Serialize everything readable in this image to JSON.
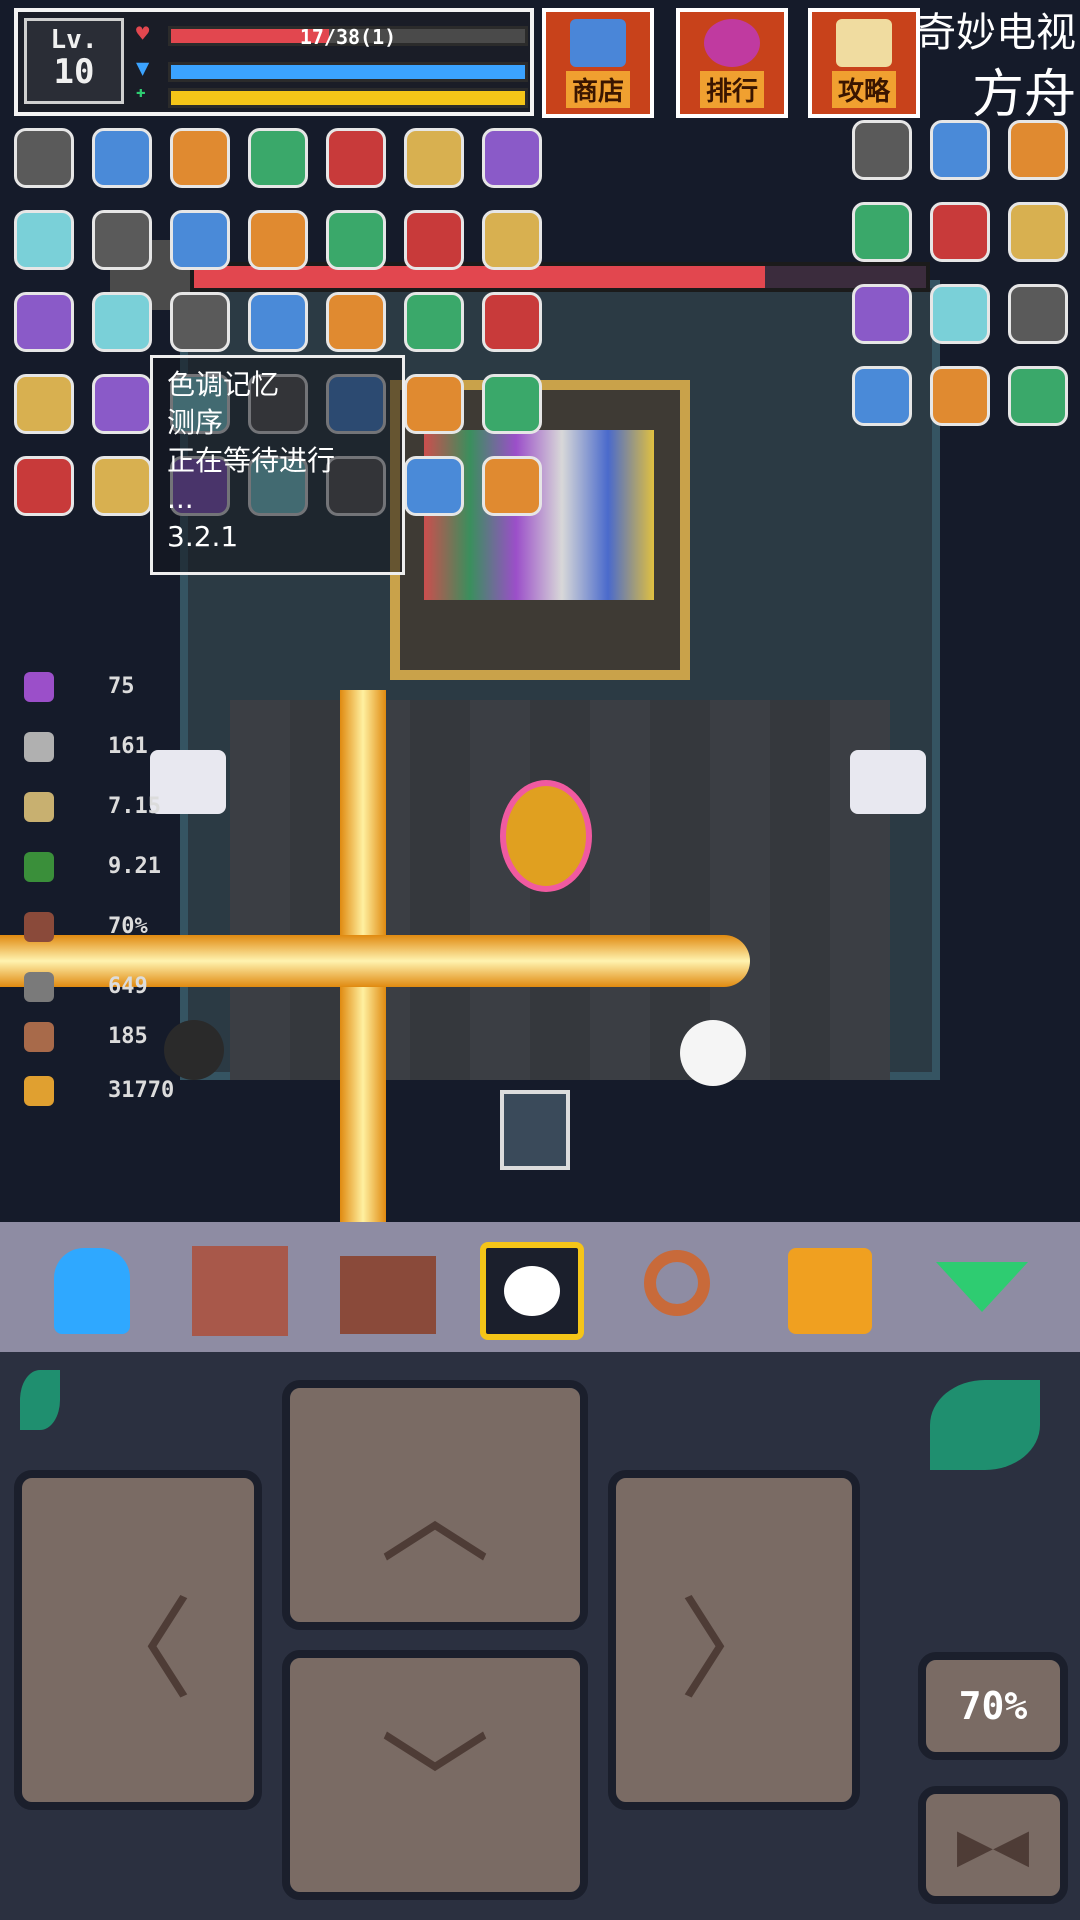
{
  "hud": {
    "level_label": "Lv.",
    "level_value": "10",
    "hp_text": "17/38(1)",
    "hp_fraction": 0.447,
    "mp_fraction": 1.0,
    "xp_fraction": 1.0,
    "icons": [
      "heart-icon",
      "mana-icon",
      "xp-icon"
    ]
  },
  "shop_buttons": [
    {
      "label": "商店",
      "icon": "shopping-bag-icon"
    },
    {
      "label": "排行",
      "icon": "trophy-icon"
    },
    {
      "label": "攻略",
      "icon": "scroll-icon"
    }
  ],
  "watermark": {
    "line1": "奇妙电视",
    "line2": "方舟"
  },
  "boss": {
    "hp_fraction": 0.78,
    "icon": "boss-skull-icon"
  },
  "tooltip": {
    "line1": "色调记忆",
    "line2": "测序",
    "line3": "正在等待进行",
    "line4": "...",
    "line5": "3.2.1"
  },
  "stats": [
    {
      "icon": "gem-icon",
      "value": "75",
      "color": "#9b4fc9"
    },
    {
      "icon": "crossed-swords-icon",
      "value": "161",
      "color": "#b0b0b0"
    },
    {
      "icon": "speed-sword-icon",
      "value": "7.15",
      "color": "#c8b070"
    },
    {
      "icon": "boot-icon",
      "value": "9.21",
      "color": "#3a8f3a"
    },
    {
      "icon": "shield-icon",
      "value": "70%",
      "color": "#8a4a3a"
    },
    {
      "icon": "crit-icon",
      "value": "649",
      "color": "#7a7a7a"
    },
    {
      "icon": "key-icon",
      "value": "185",
      "color": "#a86a4a"
    },
    {
      "icon": "coin-icon",
      "value": "31770",
      "color": "#e0a030"
    }
  ],
  "toolbar": {
    "items": [
      {
        "name": "character-icon",
        "color": "#2fa8ff"
      },
      {
        "name": "spellbook-icon",
        "color": "#a8584a"
      },
      {
        "name": "inventory-bag-icon",
        "color": "#8a4a3a"
      },
      {
        "name": "cloud-skill-icon",
        "color": "#ffffff"
      },
      {
        "name": "search-icon",
        "color": "#c86a3a"
      },
      {
        "name": "pause-icon",
        "color": "#f0a020"
      },
      {
        "name": "collapse-arrow-icon",
        "color": "#2ecc71"
      }
    ]
  },
  "controls": {
    "up": "︿",
    "down": "﹀",
    "left": "〈",
    "right": "〉",
    "speed_label": "70%",
    "flip_label": "▶◀"
  }
}
